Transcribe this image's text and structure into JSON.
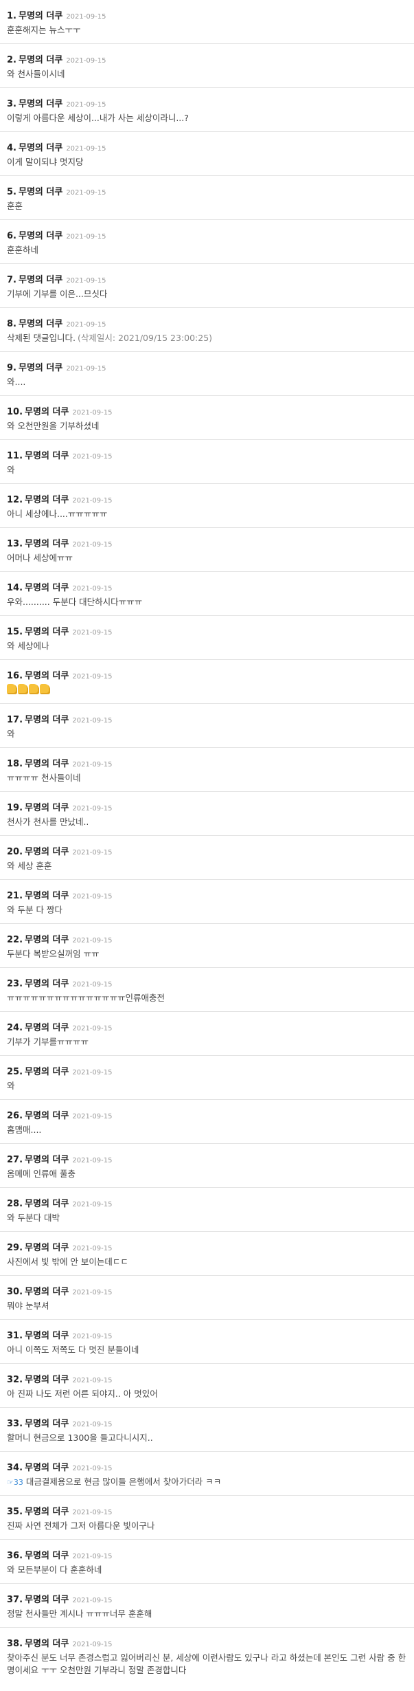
{
  "comments": [
    {
      "num": "1.",
      "author": "무명의 더쿠",
      "date": "2021-09-15",
      "text": "훈훈해지는 뉴스ㅜㅜ"
    },
    {
      "num": "2.",
      "author": "무명의 더쿠",
      "date": "2021-09-15",
      "text": "와 천사들이시네"
    },
    {
      "num": "3.",
      "author": "무명의 더쿠",
      "date": "2021-09-15",
      "text": "이렇게 아름다운 세상이...내가 사는 세상이라니...?"
    },
    {
      "num": "4.",
      "author": "무명의 더쿠",
      "date": "2021-09-15",
      "text": "이게 말이되냐 멋지당"
    },
    {
      "num": "5.",
      "author": "무명의 더쿠",
      "date": "2021-09-15",
      "text": "훈훈"
    },
    {
      "num": "6.",
      "author": "무명의 더쿠",
      "date": "2021-09-15",
      "text": "훈훈하네"
    },
    {
      "num": "7.",
      "author": "무명의 더쿠",
      "date": "2021-09-15",
      "text": "기부에 기부를 이은...므싯다"
    },
    {
      "num": "8.",
      "author": "무명의 더쿠",
      "date": "2021-09-15",
      "text": "삭제된 댓글입니다.",
      "deleted_note": "(삭제일시: 2021/09/15 23:00:25)"
    },
    {
      "num": "9.",
      "author": "무명의 더쿠",
      "date": "2021-09-15",
      "text": "와...."
    },
    {
      "num": "10.",
      "author": "무명의 더쿠",
      "date": "2021-09-15",
      "text": "와 오천만원을 기부하셨네"
    },
    {
      "num": "11.",
      "author": "무명의 더쿠",
      "date": "2021-09-15",
      "text": "와"
    },
    {
      "num": "12.",
      "author": "무명의 더쿠",
      "date": "2021-09-15",
      "text": "아니 세상에나....ㅠㅠㅠㅠㅠ"
    },
    {
      "num": "13.",
      "author": "무명의 더쿠",
      "date": "2021-09-15",
      "text": "어머나 세상에ㅠㅠ"
    },
    {
      "num": "14.",
      "author": "무명의 더쿠",
      "date": "2021-09-15",
      "text": "우와.......... 두분다 대단하시다ㅠㅠㅠ"
    },
    {
      "num": "15.",
      "author": "무명의 더쿠",
      "date": "2021-09-15",
      "text": "와 세상에나"
    },
    {
      "num": "16.",
      "author": "무명의 더쿠",
      "date": "2021-09-15",
      "emoji": "thumbs-up-icon",
      "emoji_count": 4
    },
    {
      "num": "17.",
      "author": "무명의 더쿠",
      "date": "2021-09-15",
      "text": "와"
    },
    {
      "num": "18.",
      "author": "무명의 더쿠",
      "date": "2021-09-15",
      "text": "ㅠㅠㅠㅠ 천사들이네"
    },
    {
      "num": "19.",
      "author": "무명의 더쿠",
      "date": "2021-09-15",
      "text": "천사가 천사를 만났네.."
    },
    {
      "num": "20.",
      "author": "무명의 더쿠",
      "date": "2021-09-15",
      "text": "와 세상 훈훈"
    },
    {
      "num": "21.",
      "author": "무명의 더쿠",
      "date": "2021-09-15",
      "text": "와 두분 다 짱다"
    },
    {
      "num": "22.",
      "author": "무명의 더쿠",
      "date": "2021-09-15",
      "text": "두분다 복받으실꺼임 ㅠㅠ"
    },
    {
      "num": "23.",
      "author": "무명의 더쿠",
      "date": "2021-09-15",
      "text": "ㅠㅠㅠㅠㅠㅠㅠㅠㅠㅠㅠㅠㅠㅠㅠ인류애충전"
    },
    {
      "num": "24.",
      "author": "무명의 더쿠",
      "date": "2021-09-15",
      "text": "기부가 기부를ㅠㅠㅠㅠ"
    },
    {
      "num": "25.",
      "author": "무명의 더쿠",
      "date": "2021-09-15",
      "text": "와"
    },
    {
      "num": "26.",
      "author": "무명의 더쿠",
      "date": "2021-09-15",
      "text": "홈맴매...."
    },
    {
      "num": "27.",
      "author": "무명의 더쿠",
      "date": "2021-09-15",
      "text": "옴메메 인류애 풀충"
    },
    {
      "num": "28.",
      "author": "무명의 더쿠",
      "date": "2021-09-15",
      "text": "와 두분다 대박"
    },
    {
      "num": "29.",
      "author": "무명의 더쿠",
      "date": "2021-09-15",
      "text": "사진에서 빛 밖에 안 보이는데ㄷㄷ"
    },
    {
      "num": "30.",
      "author": "무명의 더쿠",
      "date": "2021-09-15",
      "text": "뭐야 눈부셔"
    },
    {
      "num": "31.",
      "author": "무명의 더쿠",
      "date": "2021-09-15",
      "text": "아니 이쪽도 저쪽도 다 멋진 분들이네"
    },
    {
      "num": "32.",
      "author": "무명의 더쿠",
      "date": "2021-09-15",
      "text": "아 진짜 나도 저런 어른 되야지.. 아 멋있어"
    },
    {
      "num": "33.",
      "author": "무명의 더쿠",
      "date": "2021-09-15",
      "text": "할머니 현금으로 1300을 들고다니시지.."
    },
    {
      "num": "34.",
      "author": "무명의 더쿠",
      "date": "2021-09-15",
      "prefix": "☞33",
      "text": "대금결제용으로 현금 많이들 은행에서 찾아가더라 ㅋㅋ"
    },
    {
      "num": "35.",
      "author": "무명의 더쿠",
      "date": "2021-09-15",
      "text": "진짜 사연 전체가 그저 아름다운 빛이구나"
    },
    {
      "num": "36.",
      "author": "무명의 더쿠",
      "date": "2021-09-15",
      "text": "와 모든부분이 다 훈훈하네"
    },
    {
      "num": "37.",
      "author": "무명의 더쿠",
      "date": "2021-09-15",
      "text": "정말 천사들만 계시나 ㅠㅠㅠ너무 훈훈해"
    },
    {
      "num": "38.",
      "author": "무명의 더쿠",
      "date": "2021-09-15",
      "text": "찾아주신 분도 너무 존경스럽고 잃어버리신 분, 세상에 이런사람도 있구나 라고 하셨는데 본인도 그런 사람 중 한명이세요 ㅜㅜ 오천만원 기부라니 정말 존경합니다"
    }
  ]
}
